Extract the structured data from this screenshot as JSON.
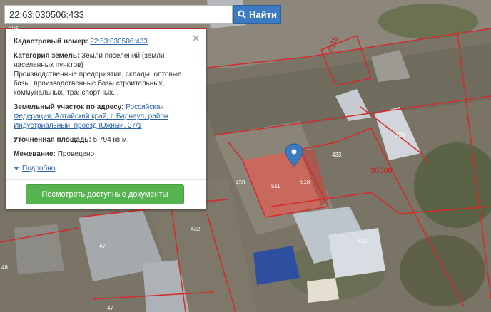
{
  "search": {
    "value": "22:63:030506:433",
    "button_label": "Найти"
  },
  "popup": {
    "cadastral_label": "Кадастровый номер:",
    "cadastral_value": "22:63:030506:433",
    "category_label": "Категория земель:",
    "category_value": "Земли поселений (земли населенных пунктов)",
    "usage_text": "Производственные предприятия, склады, оптовые базы, производственные базы строительных, коммунальных, транспортных...",
    "address_label": "Земельный участок по адресу:",
    "address_value": "Российская Федерация, Алтайский край, г. Барнаул, район Индустриальный, проезд Южный, 37/1",
    "area_label": "Уточненная площадь:",
    "area_value": "5 794 кв.м.",
    "survey_label": "Межевание:",
    "survey_value": "Проведено",
    "more_label": "Подробно",
    "docs_button": "Посмотреть доступные документы"
  },
  "map_labels": {
    "l594": "594",
    "l2015": "2015",
    "l326": "326",
    "l30506": "30506",
    "l433a": "433",
    "l433b": "433",
    "l511": "511",
    "l518": "518",
    "l432a": "432",
    "l432b": "432",
    "l47a": "47",
    "l47b": "47",
    "l48": "48"
  },
  "colors": {
    "search_button": "#3c7bc2",
    "docs_button": "#55b44f",
    "marker": "#3c7bc2",
    "boundary": "#d42a2a"
  }
}
